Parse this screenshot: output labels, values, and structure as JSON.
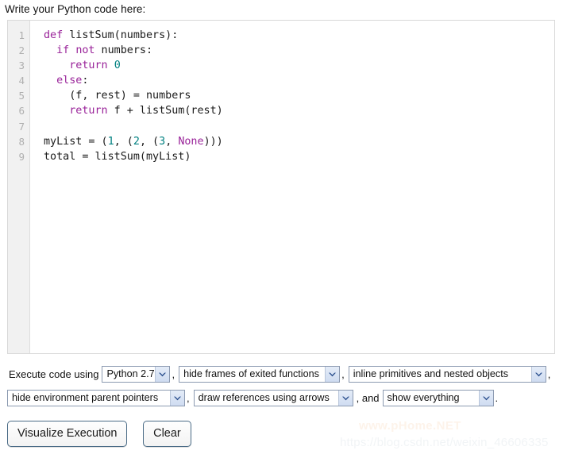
{
  "page": {
    "label": "Write your Python code here:"
  },
  "editor": {
    "line_numbers": [
      "1",
      "2",
      "3",
      "4",
      "5",
      "6",
      "7",
      "8",
      "9"
    ],
    "lines": [
      [
        {
          "t": "def",
          "c": "kw"
        },
        {
          "t": " listSum(numbers):",
          "c": "pl"
        }
      ],
      [
        {
          "t": "  ",
          "c": "pl"
        },
        {
          "t": "if",
          "c": "kw"
        },
        {
          "t": " ",
          "c": "pl"
        },
        {
          "t": "not",
          "c": "kw"
        },
        {
          "t": " numbers:",
          "c": "pl"
        }
      ],
      [
        {
          "t": "    ",
          "c": "pl"
        },
        {
          "t": "return",
          "c": "kw"
        },
        {
          "t": " ",
          "c": "pl"
        },
        {
          "t": "0",
          "c": "num"
        }
      ],
      [
        {
          "t": "  ",
          "c": "pl"
        },
        {
          "t": "else",
          "c": "kw"
        },
        {
          "t": ":",
          "c": "pl"
        }
      ],
      [
        {
          "t": "    (f, rest) = numbers",
          "c": "pl"
        }
      ],
      [
        {
          "t": "    ",
          "c": "pl"
        },
        {
          "t": "return",
          "c": "kw"
        },
        {
          "t": " f + listSum(rest)",
          "c": "pl"
        }
      ],
      [
        {
          "t": "",
          "c": "pl"
        }
      ],
      [
        {
          "t": "myList = (",
          "c": "pl"
        },
        {
          "t": "1",
          "c": "num"
        },
        {
          "t": ", (",
          "c": "pl"
        },
        {
          "t": "2",
          "c": "num"
        },
        {
          "t": ", (",
          "c": "pl"
        },
        {
          "t": "3",
          "c": "num"
        },
        {
          "t": ", ",
          "c": "pl"
        },
        {
          "t": "None",
          "c": "kw"
        },
        {
          "t": ")))",
          "c": "pl"
        }
      ],
      [
        {
          "t": "total = listSum(myList)",
          "c": "pl"
        }
      ]
    ],
    "colors": {
      "keyword": "#992299",
      "number": "#008080",
      "plain": "#1a1a1a",
      "gutter_bg": "#f1f1f1",
      "gutter_text": "#b0b0b0",
      "border": "#d9d9d9"
    }
  },
  "options": {
    "prefix_text": "Execute code using",
    "and_text": ", and",
    "comma": ",",
    "period": ".",
    "version_select": {
      "value": "Python 2.7"
    },
    "frames_select": {
      "value": "hide frames of exited functions"
    },
    "inline_select": {
      "value": "inline primitives and nested objects"
    },
    "env_pointers_select": {
      "value": "hide environment parent pointers"
    },
    "references_select": {
      "value": "draw references using arrows"
    },
    "detail_select": {
      "value": "show everything"
    }
  },
  "buttons": {
    "visualize_label": "Visualize Execution",
    "clear_label": "Clear"
  },
  "watermarks": {
    "phome": "www.pHome.NET",
    "csdn": "https://blog.csdn.net/weixin_46606335"
  }
}
